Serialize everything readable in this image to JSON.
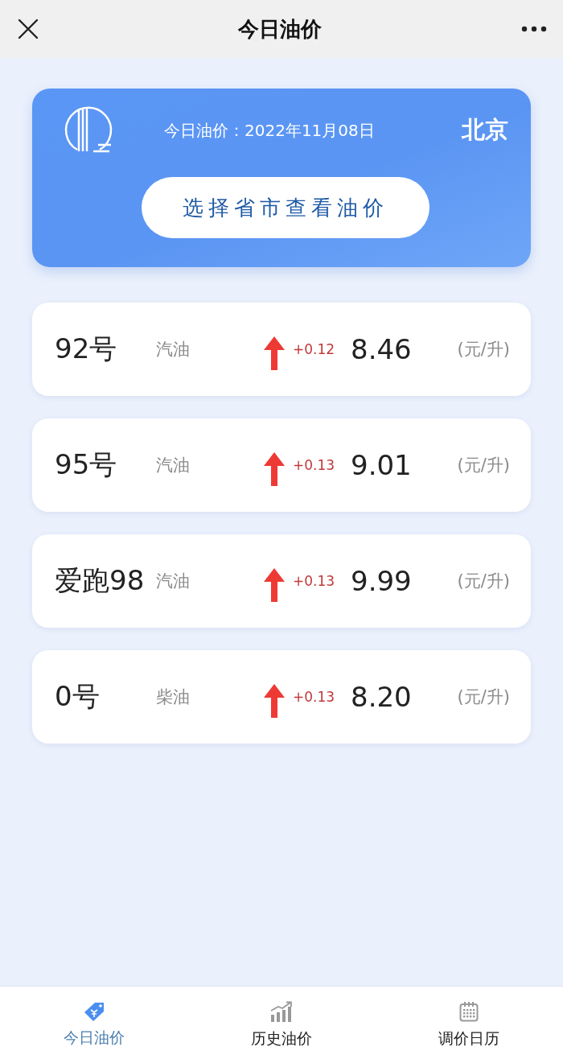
{
  "window": {
    "title": "今日油价"
  },
  "banner": {
    "date_label": "今日油价：2022年11月08日",
    "city": "北京",
    "button": "选择省市查看油价"
  },
  "prices": [
    {
      "grade": "92号",
      "fuel": "汽油",
      "kind": "increase",
      "change": "+0.12",
      "price": "8.46",
      "unit": "(元/升)"
    },
    {
      "grade": "95号",
      "fuel": "汽油",
      "kind": "increase",
      "change": "+0.13",
      "price": "9.01",
      "unit": "(元/升)"
    },
    {
      "grade": "爱跑98",
      "fuel": "汽油",
      "kind": "increase",
      "change": "+0.13",
      "price": "9.99",
      "unit": "(元/升)"
    },
    {
      "grade": "0号",
      "fuel": "柴油",
      "kind": "increase",
      "change": "+0.13",
      "price": "8.20",
      "unit": "(元/升)"
    }
  ],
  "tabs": [
    {
      "label": "今日油价",
      "kind": "tag",
      "selected": true
    },
    {
      "label": "历史油价",
      "kind": "chart",
      "selected": false
    },
    {
      "label": "调价日历",
      "kind": "calendar",
      "selected": false
    }
  ]
}
